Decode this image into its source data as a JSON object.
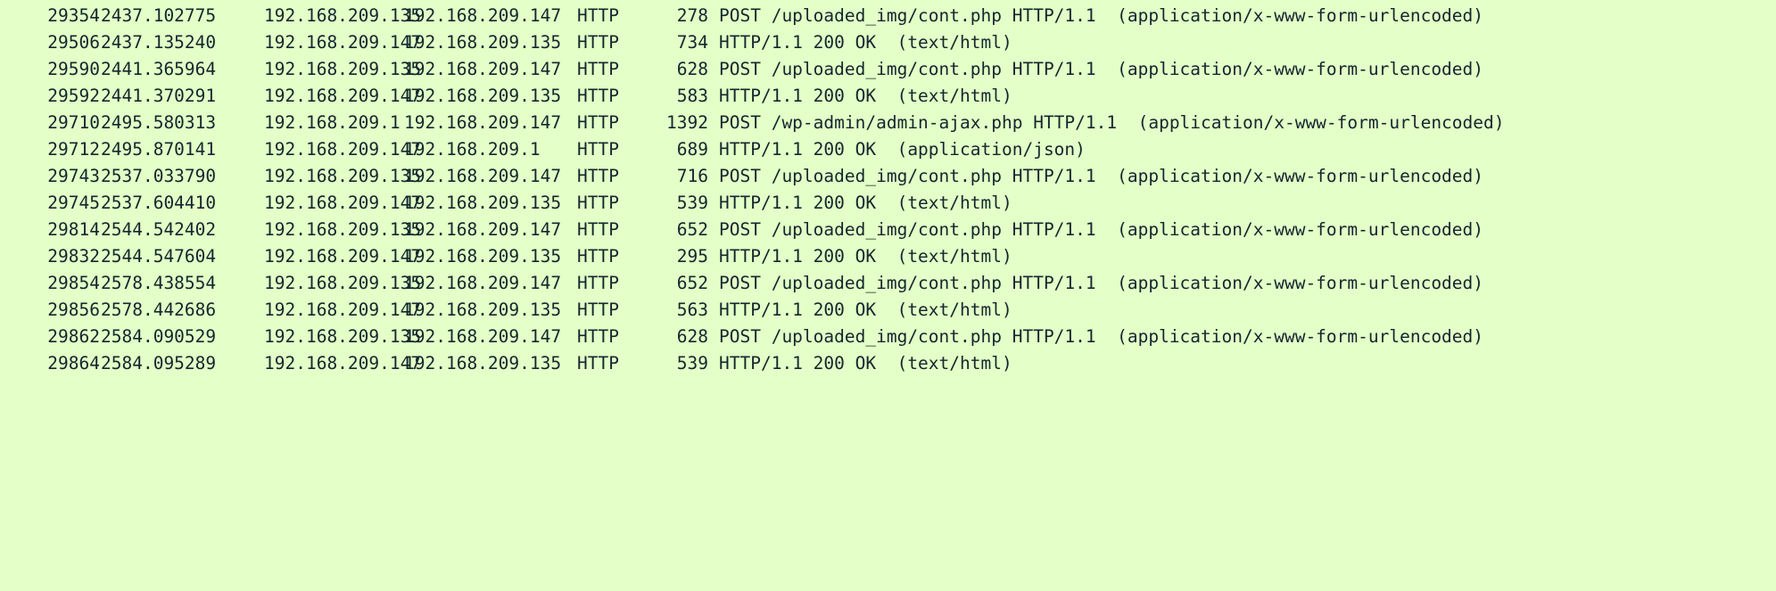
{
  "theme": {
    "row_background": "#e4ffc7",
    "text_color": "#12272e"
  },
  "packets": [
    {
      "no": "29354",
      "time": "2437.102775",
      "source": "192.168.209.135",
      "destination": "192.168.209.147",
      "protocol": "HTTP",
      "length": "278",
      "info": "POST /uploaded_img/cont.php HTTP/1.1  (application/x-www-form-urlencoded)"
    },
    {
      "no": "29506",
      "time": "2437.135240",
      "source": "192.168.209.147",
      "destination": "192.168.209.135",
      "protocol": "HTTP",
      "length": "734",
      "info": "HTTP/1.1 200 OK  (text/html)"
    },
    {
      "no": "29590",
      "time": "2441.365964",
      "source": "192.168.209.135",
      "destination": "192.168.209.147",
      "protocol": "HTTP",
      "length": "628",
      "info": "POST /uploaded_img/cont.php HTTP/1.1  (application/x-www-form-urlencoded)"
    },
    {
      "no": "29592",
      "time": "2441.370291",
      "source": "192.168.209.147",
      "destination": "192.168.209.135",
      "protocol": "HTTP",
      "length": "583",
      "info": "HTTP/1.1 200 OK  (text/html)"
    },
    {
      "no": "29710",
      "time": "2495.580313",
      "source": "192.168.209.1",
      "destination": "192.168.209.147",
      "protocol": "HTTP",
      "length": "1392",
      "info": "POST /wp-admin/admin-ajax.php HTTP/1.1  (application/x-www-form-urlencoded)"
    },
    {
      "no": "29712",
      "time": "2495.870141",
      "source": "192.168.209.147",
      "destination": "192.168.209.1",
      "protocol": "HTTP",
      "length": "689",
      "info": "HTTP/1.1 200 OK  (application/json)"
    },
    {
      "no": "29743",
      "time": "2537.033790",
      "source": "192.168.209.135",
      "destination": "192.168.209.147",
      "protocol": "HTTP",
      "length": "716",
      "info": "POST /uploaded_img/cont.php HTTP/1.1  (application/x-www-form-urlencoded)"
    },
    {
      "no": "29745",
      "time": "2537.604410",
      "source": "192.168.209.147",
      "destination": "192.168.209.135",
      "protocol": "HTTP",
      "length": "539",
      "info": "HTTP/1.1 200 OK  (text/html)"
    },
    {
      "no": "29814",
      "time": "2544.542402",
      "source": "192.168.209.135",
      "destination": "192.168.209.147",
      "protocol": "HTTP",
      "length": "652",
      "info": "POST /uploaded_img/cont.php HTTP/1.1  (application/x-www-form-urlencoded)"
    },
    {
      "no": "29832",
      "time": "2544.547604",
      "source": "192.168.209.147",
      "destination": "192.168.209.135",
      "protocol": "HTTP",
      "length": "295",
      "info": "HTTP/1.1 200 OK  (text/html)"
    },
    {
      "no": "29854",
      "time": "2578.438554",
      "source": "192.168.209.135",
      "destination": "192.168.209.147",
      "protocol": "HTTP",
      "length": "652",
      "info": "POST /uploaded_img/cont.php HTTP/1.1  (application/x-www-form-urlencoded)"
    },
    {
      "no": "29856",
      "time": "2578.442686",
      "source": "192.168.209.147",
      "destination": "192.168.209.135",
      "protocol": "HTTP",
      "length": "563",
      "info": "HTTP/1.1 200 OK  (text/html)"
    },
    {
      "no": "29862",
      "time": "2584.090529",
      "source": "192.168.209.135",
      "destination": "192.168.209.147",
      "protocol": "HTTP",
      "length": "628",
      "info": "POST /uploaded_img/cont.php HTTP/1.1  (application/x-www-form-urlencoded)"
    },
    {
      "no": "29864",
      "time": "2584.095289",
      "source": "192.168.209.147",
      "destination": "192.168.209.135",
      "protocol": "HTTP",
      "length": "539",
      "info": "HTTP/1.1 200 OK  (text/html)"
    }
  ]
}
